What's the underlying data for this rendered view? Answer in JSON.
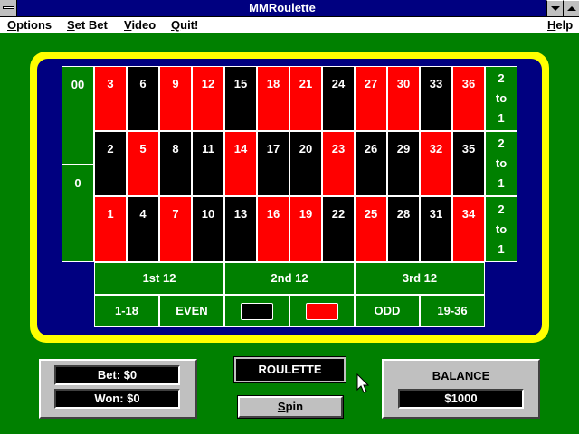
{
  "window": {
    "title": "MMRoulette"
  },
  "menu": [
    {
      "label": "Options",
      "accel": "O",
      "rest": "ptions"
    },
    {
      "label": "Set Bet",
      "accel": "S",
      "rest": "et Bet"
    },
    {
      "label": "Video",
      "accel": "V",
      "rest": "ideo"
    },
    {
      "label": "Quit!",
      "accel": "Q",
      "rest": "uit!"
    },
    {
      "label": "Help",
      "accel": "H",
      "rest": "elp"
    }
  ],
  "table": {
    "zeros": [
      "00",
      "0"
    ],
    "rows": [
      [
        {
          "n": "3",
          "c": "red"
        },
        {
          "n": "6",
          "c": "black"
        },
        {
          "n": "9",
          "c": "red"
        },
        {
          "n": "12",
          "c": "red"
        },
        {
          "n": "15",
          "c": "black"
        },
        {
          "n": "18",
          "c": "red"
        },
        {
          "n": "21",
          "c": "red"
        },
        {
          "n": "24",
          "c": "black"
        },
        {
          "n": "27",
          "c": "red"
        },
        {
          "n": "30",
          "c": "red"
        },
        {
          "n": "33",
          "c": "black"
        },
        {
          "n": "36",
          "c": "red"
        }
      ],
      [
        {
          "n": "2",
          "c": "black"
        },
        {
          "n": "5",
          "c": "red"
        },
        {
          "n": "8",
          "c": "black"
        },
        {
          "n": "11",
          "c": "black"
        },
        {
          "n": "14",
          "c": "red"
        },
        {
          "n": "17",
          "c": "black"
        },
        {
          "n": "20",
          "c": "black"
        },
        {
          "n": "23",
          "c": "red"
        },
        {
          "n": "26",
          "c": "black"
        },
        {
          "n": "29",
          "c": "black"
        },
        {
          "n": "32",
          "c": "red"
        },
        {
          "n": "35",
          "c": "black"
        }
      ],
      [
        {
          "n": "1",
          "c": "red"
        },
        {
          "n": "4",
          "c": "black"
        },
        {
          "n": "7",
          "c": "red"
        },
        {
          "n": "10",
          "c": "black"
        },
        {
          "n": "13",
          "c": "black"
        },
        {
          "n": "16",
          "c": "red"
        },
        {
          "n": "19",
          "c": "red"
        },
        {
          "n": "22",
          "c": "black"
        },
        {
          "n": "25",
          "c": "red"
        },
        {
          "n": "28",
          "c": "black"
        },
        {
          "n": "31",
          "c": "black"
        },
        {
          "n": "34",
          "c": "red"
        }
      ]
    ],
    "column_bet": [
      "2",
      "to",
      "1"
    ],
    "dozens": [
      "1st 12",
      "2nd 12",
      "3rd 12"
    ],
    "outside": {
      "low": "1-18",
      "even": "EVEN",
      "odd": "ODD",
      "high": "19-36"
    }
  },
  "status": {
    "bet": "Bet: $0",
    "won": "Won: $0",
    "game": "ROULETTE",
    "spin_accel": "S",
    "spin_rest": "pin",
    "balance_label": "BALANCE",
    "balance": "$1000"
  },
  "colors": {
    "red": "#ff0000",
    "black": "#000000",
    "felt": "#008000",
    "rail": "#ffff00",
    "board": "#000080"
  }
}
